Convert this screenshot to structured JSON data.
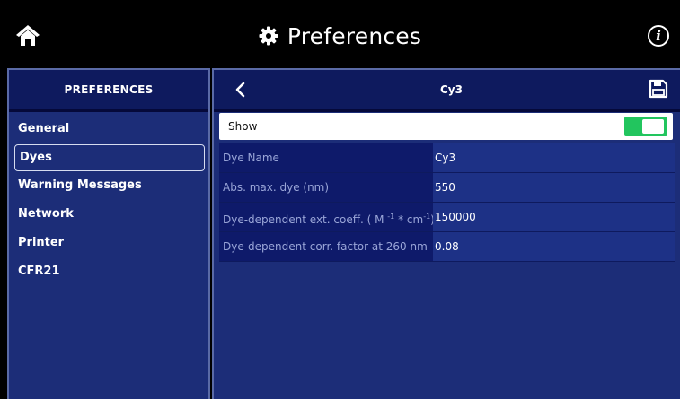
{
  "header": {
    "title": "Preferences",
    "home_icon": "home-icon",
    "settings_icon": "gear-icon",
    "info_icon": "info-icon",
    "info_glyph": "i"
  },
  "sidebar": {
    "title": "PREFERENCES",
    "items": [
      {
        "label": "General"
      },
      {
        "label": "Dyes",
        "active": true
      },
      {
        "label": "Warning Messages"
      },
      {
        "label": "Network"
      },
      {
        "label": "Printer"
      },
      {
        "label": "CFR21"
      }
    ]
  },
  "detail": {
    "title": "Cy3",
    "back_icon": "chevron-left-icon",
    "save_icon": "save-icon",
    "show": {
      "label": "Show",
      "enabled": true
    },
    "rows": [
      {
        "label": "Dye Name",
        "value": "Cy3"
      },
      {
        "label": "Abs. max. dye (nm)",
        "value": "550"
      },
      {
        "label_prefix": "Dye-dependent ext. coeff. ( M ",
        "sup1": "-1",
        "label_mid": " * cm",
        "sup2": "-1",
        "label_suffix": ")",
        "value": "150000"
      },
      {
        "label": "Dye-dependent corr. factor at 260 nm",
        "value": "0.08"
      }
    ]
  },
  "colors": {
    "panel": "#1c2d78",
    "header": "#0e1a5e",
    "toggle_on": "#22c55e"
  }
}
